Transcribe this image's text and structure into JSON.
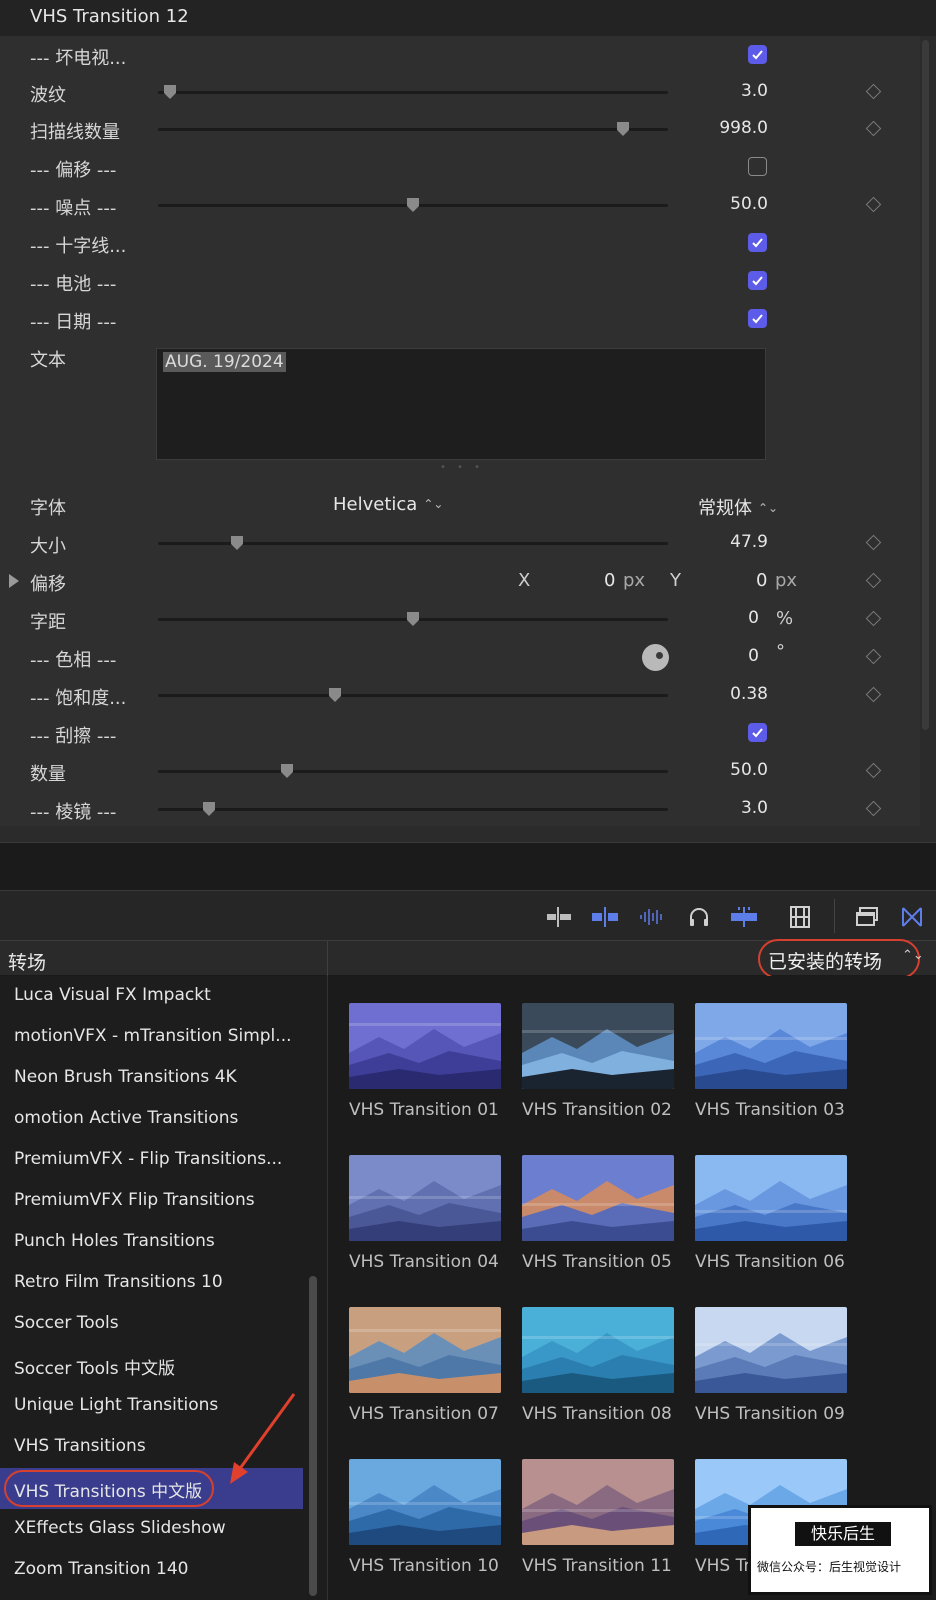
{
  "inspector": {
    "title": "VHS Transition 12",
    "rows": {
      "bad_tv": {
        "label": "--- 坏电视...",
        "checked": true
      },
      "ripple": {
        "label": "波纹",
        "value": "3.0"
      },
      "scanlines": {
        "label": "扫描线数量",
        "value": "998.0"
      },
      "offset_cb": {
        "label": "--- 偏移 ---",
        "checked": false
      },
      "noise": {
        "label": "--- 噪点 ---",
        "value": "50.0"
      },
      "crosshair": {
        "label": "--- 十字线...",
        "checked": true
      },
      "battery": {
        "label": "--- 电池 ---",
        "checked": true
      },
      "date": {
        "label": "--- 日期 ---",
        "checked": true
      },
      "text": {
        "label": "文本",
        "value": "AUG. 19/2024"
      },
      "font": {
        "label": "字体",
        "family": "Helvetica",
        "style": "常规体"
      },
      "size": {
        "label": "大小",
        "value": "47.9"
      },
      "position": {
        "label": "偏移",
        "x_label": "X",
        "x_value": "0",
        "x_unit": "px",
        "y_label": "Y",
        "y_value": "0",
        "y_unit": "px"
      },
      "tracking": {
        "label": "字距",
        "value": "0",
        "unit": "%"
      },
      "hue": {
        "label": "--- 色相 ---",
        "value": "0",
        "unit": "°"
      },
      "saturation": {
        "label": "--- 饱和度...",
        "value": "0.38"
      },
      "scratch": {
        "label": "--- 刮擦 ---",
        "checked": true
      },
      "amount": {
        "label": "数量",
        "value": "50.0"
      },
      "prism": {
        "label": "--- 棱镜 ---",
        "value": "3.0"
      }
    }
  },
  "toolbar": {
    "icons": [
      "clip-connect-icon",
      "clip-split-icon",
      "audio-waveform-icon",
      "headphones-icon",
      "snapping-icon",
      "film-strip-icon",
      "window-stack-icon",
      "transitions-icon"
    ]
  },
  "browser": {
    "left_title": "转场",
    "filter_label": "已安装的转场",
    "list": [
      "Luca Visual FX Impackt",
      "motionVFX - mTransition Simpl...",
      "Neon Brush Transitions 4K",
      "omotion Active Transitions",
      "PremiumVFX - Flip Transitions...",
      "PremiumVFX Flip Transitions",
      "Punch Holes Transitions",
      "Retro Film Transitions 10",
      "Soccer Tools",
      "Soccer Tools 中文版",
      "Unique Light Transitions",
      "VHS Transitions",
      "VHS Transitions 中文版",
      "XEffects Glass Slideshow",
      "Zoom Transition 140"
    ],
    "selected_index": 12,
    "thumbnails": [
      "VHS Transition 01",
      "VHS Transition 02",
      "VHS Transition 03",
      "VHS Transition 04",
      "VHS Transition 05",
      "VHS Transition 06",
      "VHS Transition 07",
      "VHS Transition 08",
      "VHS Transition 09",
      "VHS Transition 10",
      "VHS Transition 11",
      "VHS Tra"
    ]
  },
  "watermark": {
    "brand": "快乐后生",
    "subtitle": "微信公众号：后生视觉设计"
  },
  "colors": {
    "accent": "#5d5ce8",
    "selection": "#3a3d8e",
    "highlight_ring": "#d5402f"
  }
}
